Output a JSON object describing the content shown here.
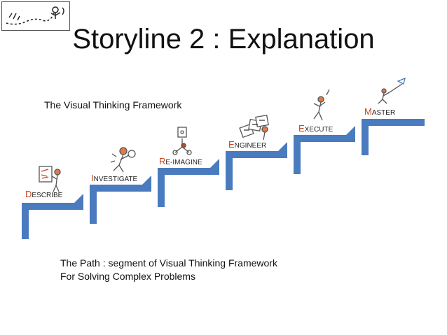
{
  "slide": {
    "title": "Storyline 2 : Explanation",
    "subtitle": "The Visual Thinking Framework",
    "footer_line1": "The Path : segment of Visual Thinking Framework",
    "footer_line2": "For Solving Complex Problems"
  },
  "steps": [
    {
      "initial": "D",
      "rest": "ESCRIBE"
    },
    {
      "initial": "I",
      "rest": "NVESTIGATE"
    },
    {
      "initial": "R",
      "rest": "E-IMAGINE"
    },
    {
      "initial": "E",
      "rest": "NGINEER"
    },
    {
      "initial": "E",
      "rest": "XECUTE"
    },
    {
      "initial": "M",
      "rest": "ASTER"
    }
  ],
  "colors": {
    "stair": "#4a7bbf",
    "initial": "#c8461e",
    "sketch": "#555555"
  }
}
